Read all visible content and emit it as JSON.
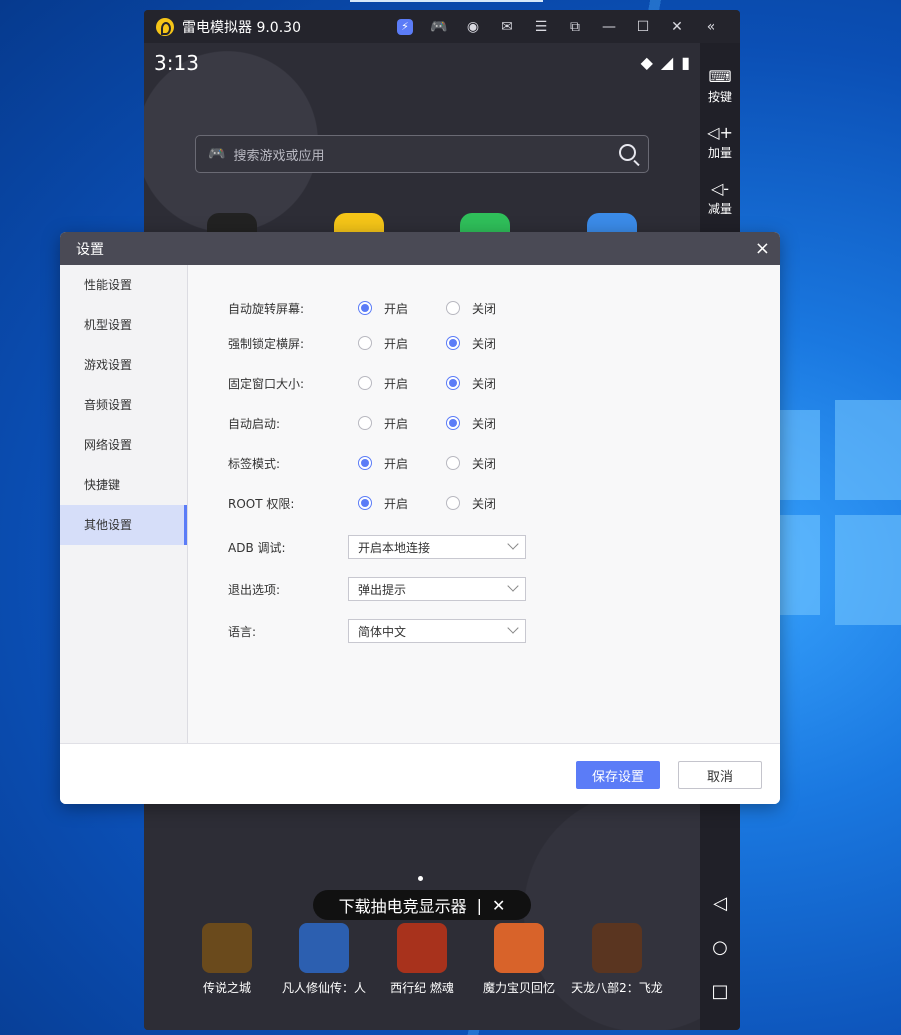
{
  "window": {
    "title": "雷电模拟器 9.0.30",
    "toolbar_icons": [
      "flash-icon",
      "gamepad-icon",
      "user-icon",
      "mail-icon",
      "menu-icon",
      "screenshot-icon",
      "minimize-icon",
      "maximize-icon",
      "close-icon",
      "collapse-icon"
    ]
  },
  "android": {
    "time": "3:13",
    "search_placeholder": "搜索游戏或应用",
    "promo_text": "下载抽电竞显示器",
    "promo_sep": "|",
    "promo_close": "✕",
    "dock_apps": [
      {
        "label": "传说之城",
        "color": "#6a4a1c"
      },
      {
        "label": "凡人修仙传：人",
        "color": "#2c5fb0"
      },
      {
        "label": "西行纪 燃魂",
        "color": "#a8321c"
      },
      {
        "label": "魔力宝贝回忆",
        "color": "#d8632a"
      },
      {
        "label": "天龙八部2：飞龙",
        "color": "#5a3520"
      }
    ]
  },
  "right_bar": {
    "items": [
      {
        "icon": "keyboard-icon",
        "label": "按键"
      },
      {
        "icon": "volume-up-icon",
        "label": "加量"
      },
      {
        "icon": "volume-down-icon",
        "label": "减量"
      }
    ]
  },
  "dialog": {
    "title": "设置",
    "close": "×",
    "sidebar": [
      "性能设置",
      "机型设置",
      "游戏设置",
      "音频设置",
      "网络设置",
      "快捷键",
      "其他设置"
    ],
    "active_index": 6,
    "on_label": "开启",
    "off_label": "关闭",
    "toggles": [
      {
        "label": "自动旋转屏幕:",
        "value": "on"
      },
      {
        "label": "强制锁定横屏:",
        "value": "off"
      },
      {
        "label": "固定窗口大小:",
        "value": "off"
      },
      {
        "label": "自动启动:",
        "value": "off"
      },
      {
        "label": "标签模式:",
        "value": "on"
      },
      {
        "label": "ROOT 权限:",
        "value": "on"
      }
    ],
    "selects": [
      {
        "label": "ADB 调试:",
        "value": "开启本地连接"
      },
      {
        "label": "退出选项:",
        "value": "弹出提示"
      },
      {
        "label": "语言:",
        "value": "简体中文"
      }
    ],
    "save_label": "保存设置",
    "cancel_label": "取消"
  }
}
